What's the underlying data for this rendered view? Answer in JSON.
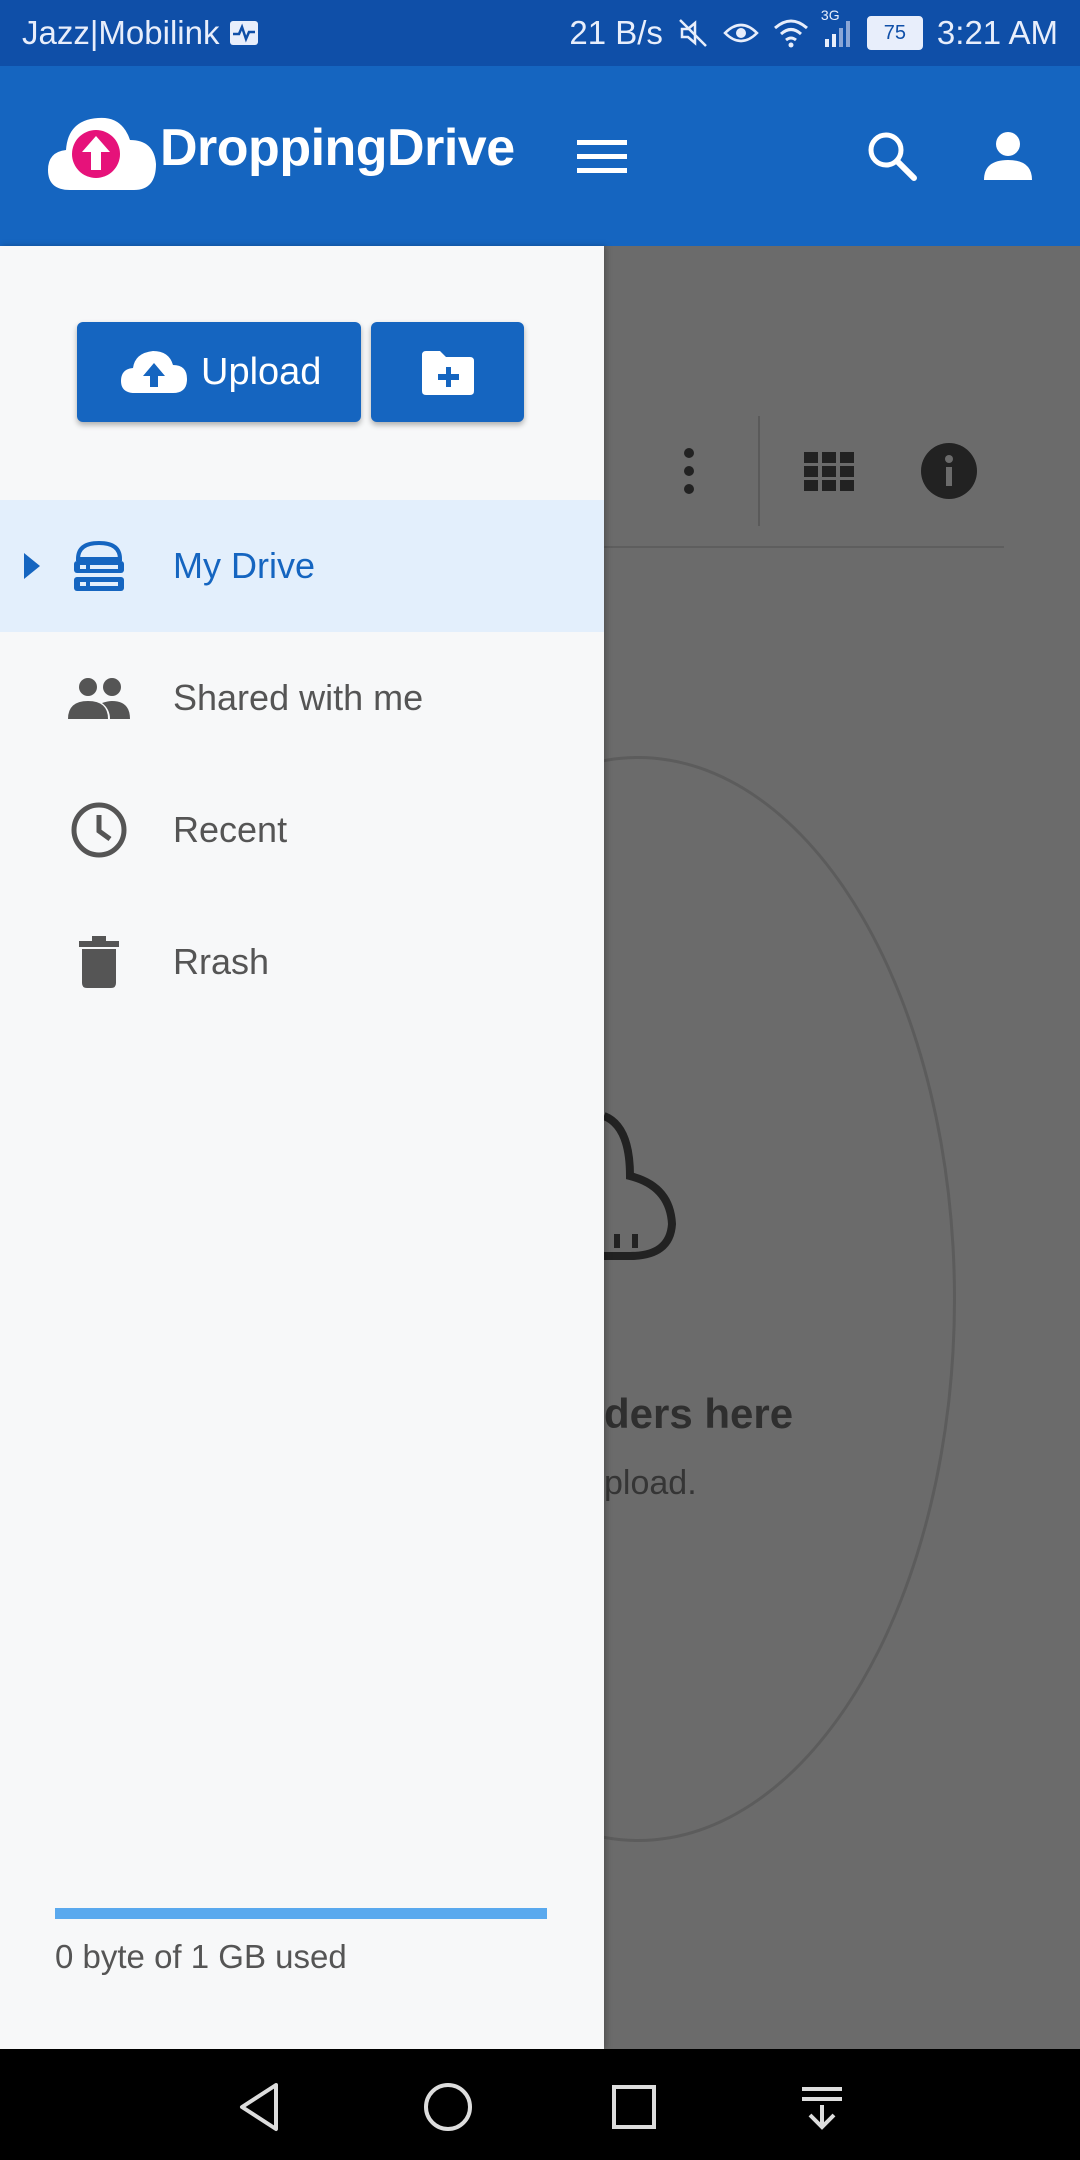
{
  "status_bar": {
    "carrier": "Jazz|Mobilink",
    "speed": "21 B/s",
    "network": "3G",
    "battery": "75",
    "time": "3:21 AM"
  },
  "app_bar": {
    "brand": "DroppingDrive",
    "color": "#1565c0",
    "icons": [
      "cloud-upload-logo",
      "menu-icon",
      "search-icon",
      "account-icon"
    ]
  },
  "drawer": {
    "upload_label": "Upload",
    "nav_items": [
      {
        "label": "My Drive",
        "icon": "storage-icon",
        "active": true
      },
      {
        "label": "Shared with me",
        "icon": "people-icon",
        "active": false
      },
      {
        "label": "Recent",
        "icon": "clock-icon",
        "active": false
      },
      {
        "label": "Rrash",
        "icon": "trash-icon",
        "active": false
      }
    ],
    "storage": {
      "text": "0 byte of 1 GB used",
      "fraction": 0
    }
  },
  "background": {
    "empty_title_fragment": "ders here",
    "empty_sub_fragment": "pload."
  },
  "system_nav": [
    "back",
    "home",
    "recents",
    "notifications-pulldown"
  ]
}
